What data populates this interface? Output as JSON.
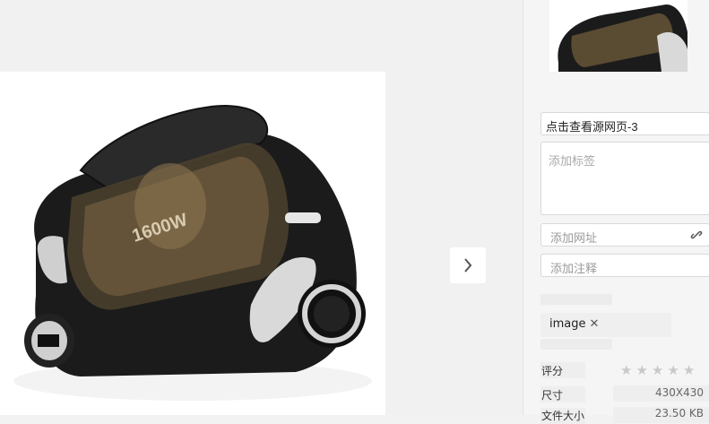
{
  "viewer": {
    "next_icon": "chevron-right-icon",
    "image_alt": "vacuum cleaner product image",
    "product_text": "1600W"
  },
  "panel": {
    "title_value": "点击查看源网页-3",
    "tags_placeholder": "添加标签",
    "url_placeholder": "添加网址",
    "note_placeholder": "添加注释",
    "link_icon": "link-icon",
    "tag_chip": "image",
    "tag_remove": "✕",
    "rating_label": "评分",
    "rating_stars": 5,
    "rating_value": 0,
    "size_label": "尺寸",
    "size_value": "430X430",
    "filesize_label": "文件大小",
    "filesize_value": "23.50 KB"
  },
  "colors": {
    "stage_bg": "#f1f1f1",
    "panel_bg": "#f5f5f5",
    "star_inactive": "#c9c9c9"
  }
}
